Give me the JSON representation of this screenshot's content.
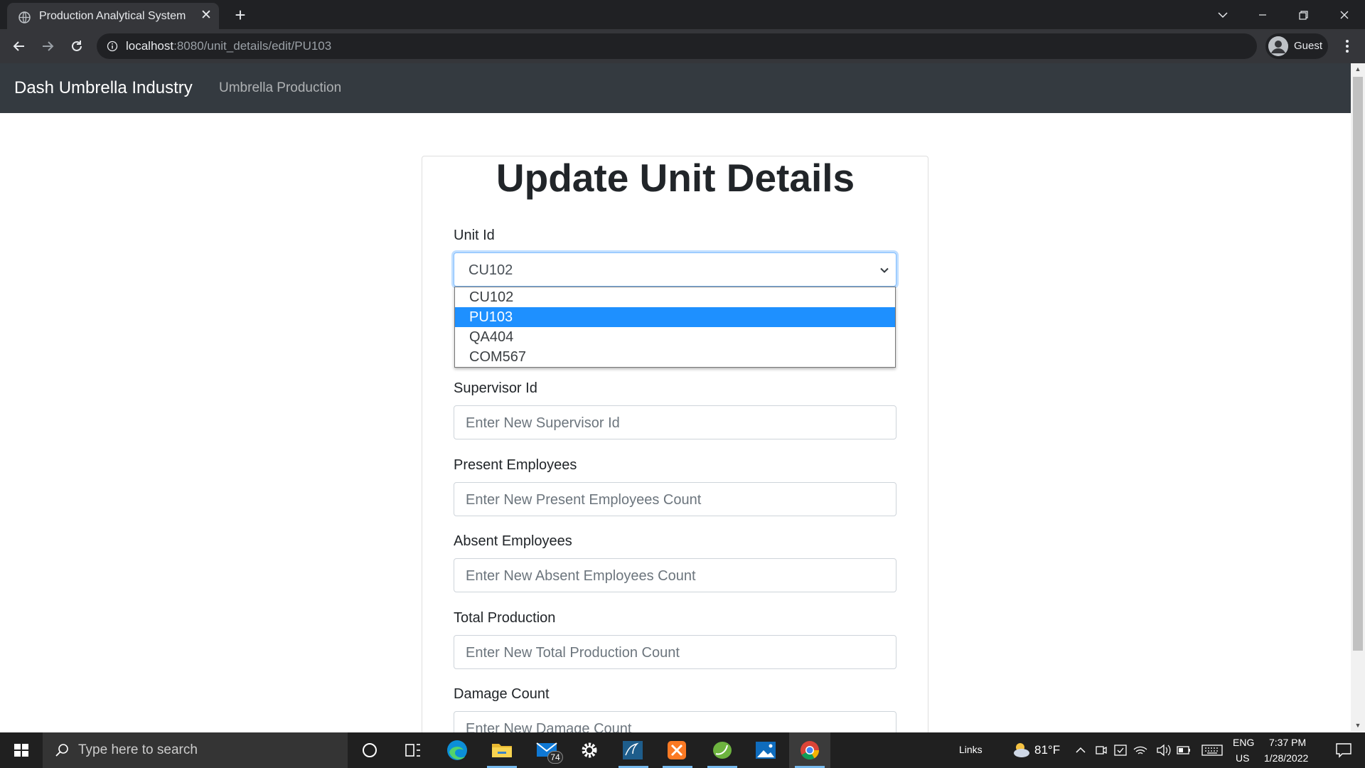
{
  "browser": {
    "tab_title": "Production Analytical System",
    "url_host": "localhost",
    "url_path": ":8080/unit_details/edit/PU103",
    "profile_label": "Guest"
  },
  "navbar": {
    "brand": "Dash Umbrella Industry",
    "link": "Umbrella Production"
  },
  "form": {
    "title": "Update Unit Details",
    "unit_id": {
      "label": "Unit Id",
      "selected": "CU102",
      "options": [
        "CU102",
        "PU103",
        "QA404",
        "COM567"
      ],
      "highlighted_option": "PU103"
    },
    "supervisor_id": {
      "label": "Supervisor Id",
      "placeholder": "Enter New Supervisor Id"
    },
    "present_employees": {
      "label": "Present Employees",
      "placeholder": "Enter New Present Employees Count"
    },
    "absent_employees": {
      "label": "Absent Employees",
      "placeholder": "Enter New Absent Employees Count"
    },
    "total_production": {
      "label": "Total Production",
      "placeholder": "Enter New Total Production Count"
    },
    "damage_count": {
      "label": "Damage Count",
      "placeholder": "Enter New Damage Count"
    }
  },
  "taskbar": {
    "search_placeholder": "Type here to search",
    "mail_badge": "74",
    "links_label": "Links",
    "weather": "81°F",
    "lang_line1": "ENG",
    "lang_line2": "US",
    "time": "7:37 PM",
    "date": "1/28/2022",
    "pinned_apps": [
      "cortana-icon",
      "task-view-icon",
      "edge-icon",
      "file-explorer-icon",
      "mail-icon",
      "settings-icon",
      "mysql-workbench-icon",
      "xampp-icon",
      "spring-tool-suite-icon",
      "photos-icon",
      "chrome-icon"
    ]
  },
  "colors": {
    "navbar_bg": "#343a40",
    "selected_option_bg": "#1e90ff",
    "chrome_dark": "#202124",
    "chrome_toolbar": "#35363a",
    "taskbar_bg": "#202020"
  }
}
